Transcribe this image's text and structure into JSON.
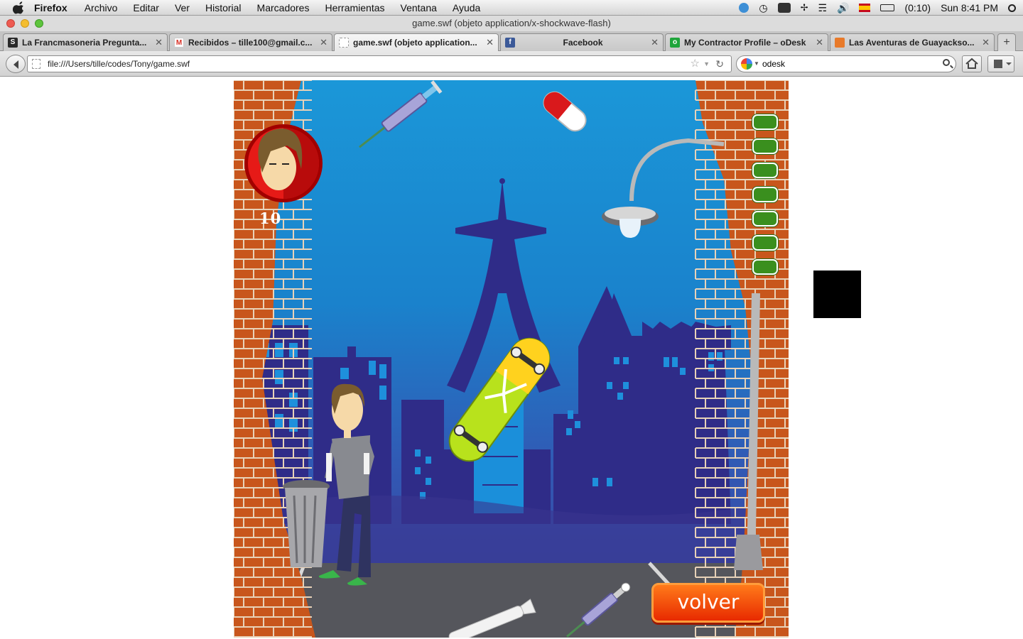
{
  "menubar": {
    "app_name": "Firefox",
    "items": [
      "Archivo",
      "Editar",
      "Ver",
      "Historial",
      "Marcadores",
      "Herramientas",
      "Ventana",
      "Ayuda"
    ],
    "battery": "(0:10)",
    "clock": "Sun 8:41 PM"
  },
  "window": {
    "title": "game.swf (objeto application/x-shockwave-flash)"
  },
  "tabs": [
    {
      "label": "La Francmasoneria Pregunta...",
      "icon": "s-icon",
      "color": "#2a2a2a"
    },
    {
      "label": "Recibidos – tille100@gmail.c...",
      "icon": "gmail-icon",
      "color": "#d93025"
    },
    {
      "label": "game.swf (objeto application...",
      "icon": "blank-page-icon",
      "color": "#ffffff"
    },
    {
      "label": "Facebook",
      "icon": "facebook-icon",
      "color": "#3b5998"
    },
    {
      "label": "My Contractor Profile – oDesk",
      "icon": "odesk-icon",
      "color": "#1fa53b"
    },
    {
      "label": "Las Aventuras de Guayackso...",
      "icon": "cartoon-icon",
      "color": "#e87a2a"
    }
  ],
  "navbar": {
    "url": "file:///Users/tille/codes/Tony/game.swf",
    "search_value": "odesk"
  },
  "game": {
    "score": "10",
    "lives": 7,
    "volver_label": "volver"
  }
}
